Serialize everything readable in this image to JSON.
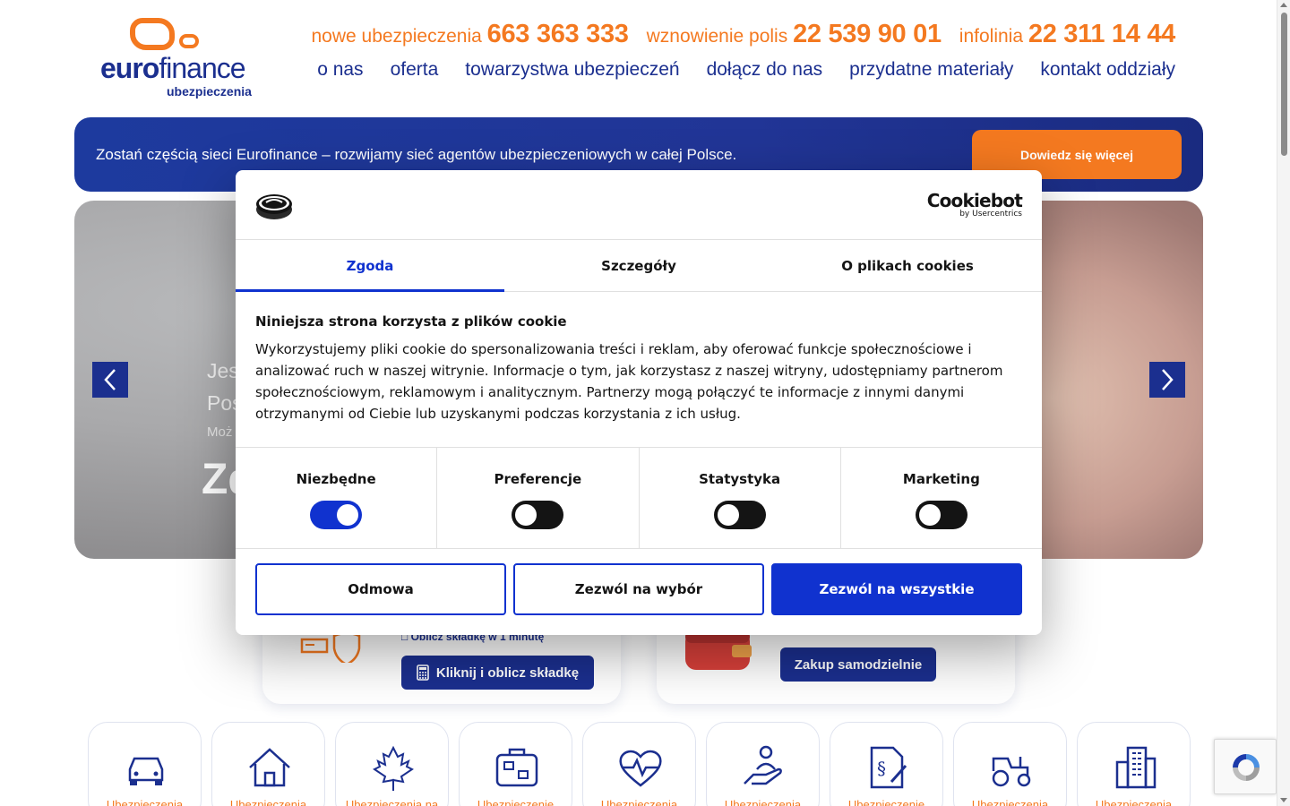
{
  "header": {
    "logo": {
      "brand_main": "euro",
      "brand_rest": "finance",
      "sub": "ubezpieczenia"
    },
    "phones": [
      {
        "label": "nowe ubezpieczenia",
        "number": "663 363 333"
      },
      {
        "label": "wznowienie polis",
        "number": "22 539 90 01"
      },
      {
        "label": "infolinia",
        "number": "22 311 14 44"
      }
    ],
    "nav": [
      "o nas",
      "oferta",
      "towarzystwa ubezpieczeń",
      "dołącz do nas",
      "przydatne materiały",
      "kontakt oddziały"
    ]
  },
  "banner": {
    "text": "Zostań częścią sieci Eurofinance – rozwijamy sieć agentów ubezpieczeniowych w całej Polsce.",
    "button": "Dowiedz się więcej"
  },
  "hero": {
    "line1": "Jes",
    "line2": "Pos",
    "line3": "Moż",
    "big": "Zd",
    "prev_icon": "chevron-left-icon",
    "next_icon": "chevron-right-icon"
  },
  "cards": {
    "calc_note": "Oblicz składkę w 1 minutę",
    "calc_button": "Kliknij i oblicz składkę",
    "buy_button": "Zakup samodzielnie"
  },
  "categories": [
    {
      "label": "Ubezpieczenia",
      "icon": "car-icon"
    },
    {
      "label": "Ubezpieczenia",
      "icon": "house-icon"
    },
    {
      "label": "Ubezpieczenia na",
      "icon": "maple-leaf-icon"
    },
    {
      "label": "Ubezpieczenie",
      "icon": "suitcase-icon"
    },
    {
      "label": "Ubezpieczenia",
      "icon": "heartbeat-icon"
    },
    {
      "label": "Ubezpieczenia",
      "icon": "hand-person-icon"
    },
    {
      "label": "Ubezpieczenie",
      "icon": "legal-document-icon"
    },
    {
      "label": "Ubezpieczenia",
      "icon": "tractor-icon"
    },
    {
      "label": "Ubezpieczenia",
      "icon": "buildings-icon"
    }
  ],
  "cookie_dialog": {
    "provider": "Cookiebot",
    "provider_by": "by Usercentrics",
    "tabs": [
      "Zgoda",
      "Szczegóły",
      "O plikach cookies"
    ],
    "active_tab": "Zgoda",
    "title": "Niniejsza strona korzysta z plików cookie",
    "body": "Wykorzystujemy pliki cookie do spersonalizowania treści i reklam, aby oferować funkcje społecznościowe i analizować ruch w naszej witrynie. Informacje o tym, jak korzystasz z naszej witryny, udostępniamy partnerom społecznościowym, reklamowym i analitycznym. Partnerzy mogą połączyć te informacje z innymi danymi otrzymanymi od Ciebie lub uzyskanymi podczas korzystania z ich usług.",
    "toggles": [
      {
        "label": "Niezbędne",
        "on": true
      },
      {
        "label": "Preferencje",
        "on": false
      },
      {
        "label": "Statystyka",
        "on": false
      },
      {
        "label": "Marketing",
        "on": false
      }
    ],
    "buttons": {
      "deny": "Odmowa",
      "allow_selection": "Zezwól na wybór",
      "allow_all": "Zezwól na wszystkie"
    }
  },
  "colors": {
    "orange": "#f47920",
    "navy": "#1b2f8f",
    "cookie_blue": "#1032cf"
  }
}
